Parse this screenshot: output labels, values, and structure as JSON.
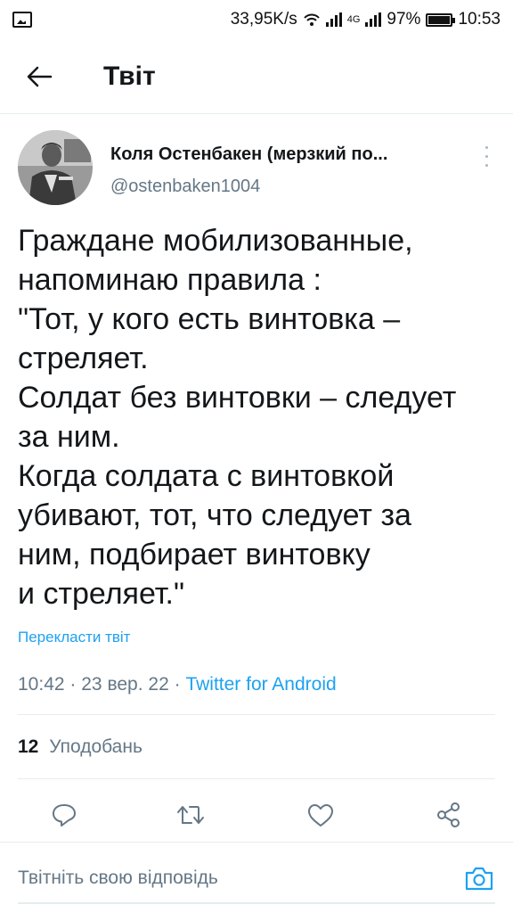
{
  "status_bar": {
    "net_speed": "33,95K/s",
    "battery_percent": "97%",
    "network_type": "4G",
    "time": "10:53",
    "battery_level": 0.97
  },
  "header": {
    "title": "Твіт",
    "back_icon": "arrow-left-icon"
  },
  "tweet": {
    "author": {
      "display_name": "Коля Остенбакен (мерзкий по...",
      "handle": "@ostenbaken1004"
    },
    "text_lines": [
      "Граждане мобилизованные,",
      "напоминаю правила :",
      "\"Тот, у кого есть винтовка –",
      "стреляет.",
      "Солдат без винтовки – следует",
      "за ним.",
      "Когда солдата с винтовкой",
      "убивают, тот, что следует за",
      "ним, подбирает винтовку",
      "и стреляет.\""
    ],
    "translate_label": "Перекласти твіт",
    "time": "10:42",
    "date": "23 вер. 22",
    "separator": "·",
    "source": "Twitter for Android",
    "likes_count": "12",
    "likes_label": "Уподобань"
  },
  "actions": {
    "icons": [
      "reply-icon",
      "retweet-icon",
      "like-icon",
      "share-icon"
    ]
  },
  "reply": {
    "placeholder": "Твітніть свою відповідь",
    "camera_icon": "camera-icon"
  },
  "colors": {
    "accent": "#1da1f2",
    "secondary_text": "#657786",
    "primary_text": "#14171a",
    "divider": "#e6ecf0"
  }
}
